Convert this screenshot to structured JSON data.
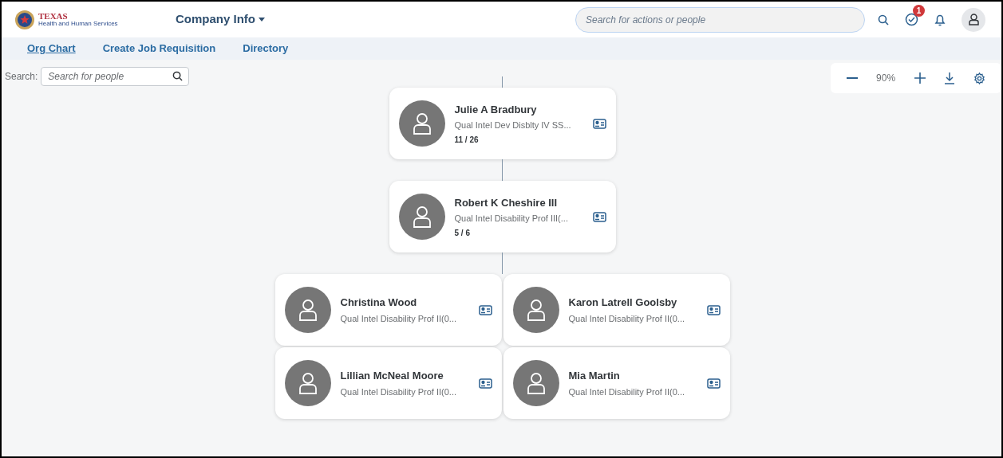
{
  "header": {
    "logo": {
      "title": "TEXAS",
      "subtitle": "Health and Human Services"
    },
    "app_menu": "Company Info",
    "search": {
      "placeholder": "Search for actions or people"
    },
    "tasks_badge": "1"
  },
  "nav_tabs": [
    {
      "label": "Org Chart",
      "selected": true
    },
    {
      "label": "Create Job Requisition",
      "selected": false
    },
    {
      "label": "Directory",
      "selected": false
    }
  ],
  "people_search": {
    "label": "Search:",
    "placeholder": "Search for people"
  },
  "zoom": {
    "reading": "90%"
  },
  "org_chart": {
    "name": "Julie A Bradbury",
    "title": "Qual Intel Dev Disblty IV SS...",
    "count": "11 / 26",
    "children": [
      {
        "name": "Robert K Cheshire III",
        "title": "Qual Intel Disability Prof III(...",
        "count": "5 / 6",
        "children": [
          {
            "name": "Christina Wood",
            "title": "Qual Intel Disability Prof II(0..."
          },
          {
            "name": "Karon Latrell Goolsby",
            "title": "Qual Intel Disability Prof II(0..."
          },
          {
            "name": "Lillian McNeal Moore",
            "title": "Qual Intel Disability Prof II(0..."
          },
          {
            "name": "Mia Martin",
            "title": "Qual Intel Disability Prof II(0..."
          }
        ]
      }
    ]
  }
}
